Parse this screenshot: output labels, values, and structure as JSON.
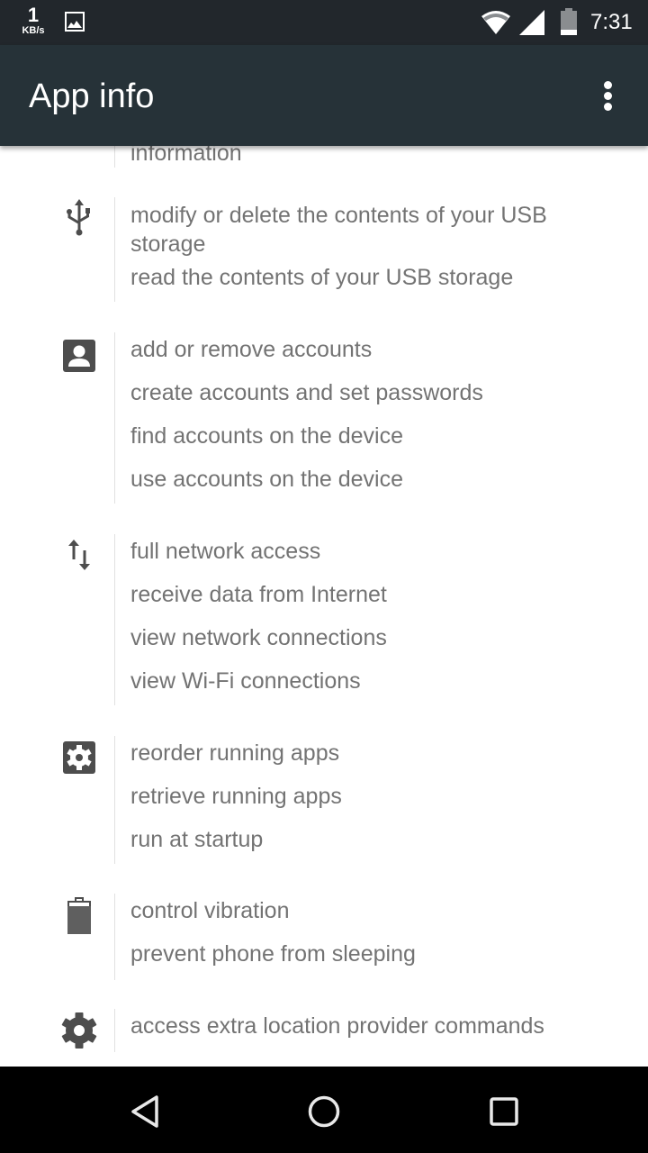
{
  "status_bar": {
    "net_speed_value": "1",
    "net_speed_unit": "KB/s",
    "time": "7:31",
    "icons": [
      "image-notification-icon",
      "wifi-icon",
      "cell-signal-icon",
      "battery-icon"
    ]
  },
  "app_bar": {
    "title": "App info",
    "overflow_icon": "more-vert-icon"
  },
  "permission_groups": [
    {
      "icon": "none",
      "items": [
        "information"
      ]
    },
    {
      "icon": "usb-icon",
      "items": [
        "modify or delete the contents of your USB storage",
        "read the contents of your USB storage"
      ]
    },
    {
      "icon": "account-box-icon",
      "items": [
        "add or remove accounts",
        "create accounts and set passwords",
        "find accounts on the device",
        "use accounts on the device"
      ]
    },
    {
      "icon": "network-arrows-icon",
      "items": [
        "full network access",
        "receive data from Internet",
        "view network connections",
        "view Wi-Fi connections"
      ]
    },
    {
      "icon": "settings-box-icon",
      "items": [
        "reorder running apps",
        "retrieve running apps",
        "run at startup"
      ]
    },
    {
      "icon": "battery-icon",
      "items": [
        "control vibration",
        "prevent phone from sleeping"
      ]
    },
    {
      "icon": "gear-icon",
      "items": [
        "access extra location provider commands"
      ]
    }
  ],
  "nav_bar": {
    "back": "back-icon",
    "home": "home-icon",
    "recents": "recents-icon"
  }
}
